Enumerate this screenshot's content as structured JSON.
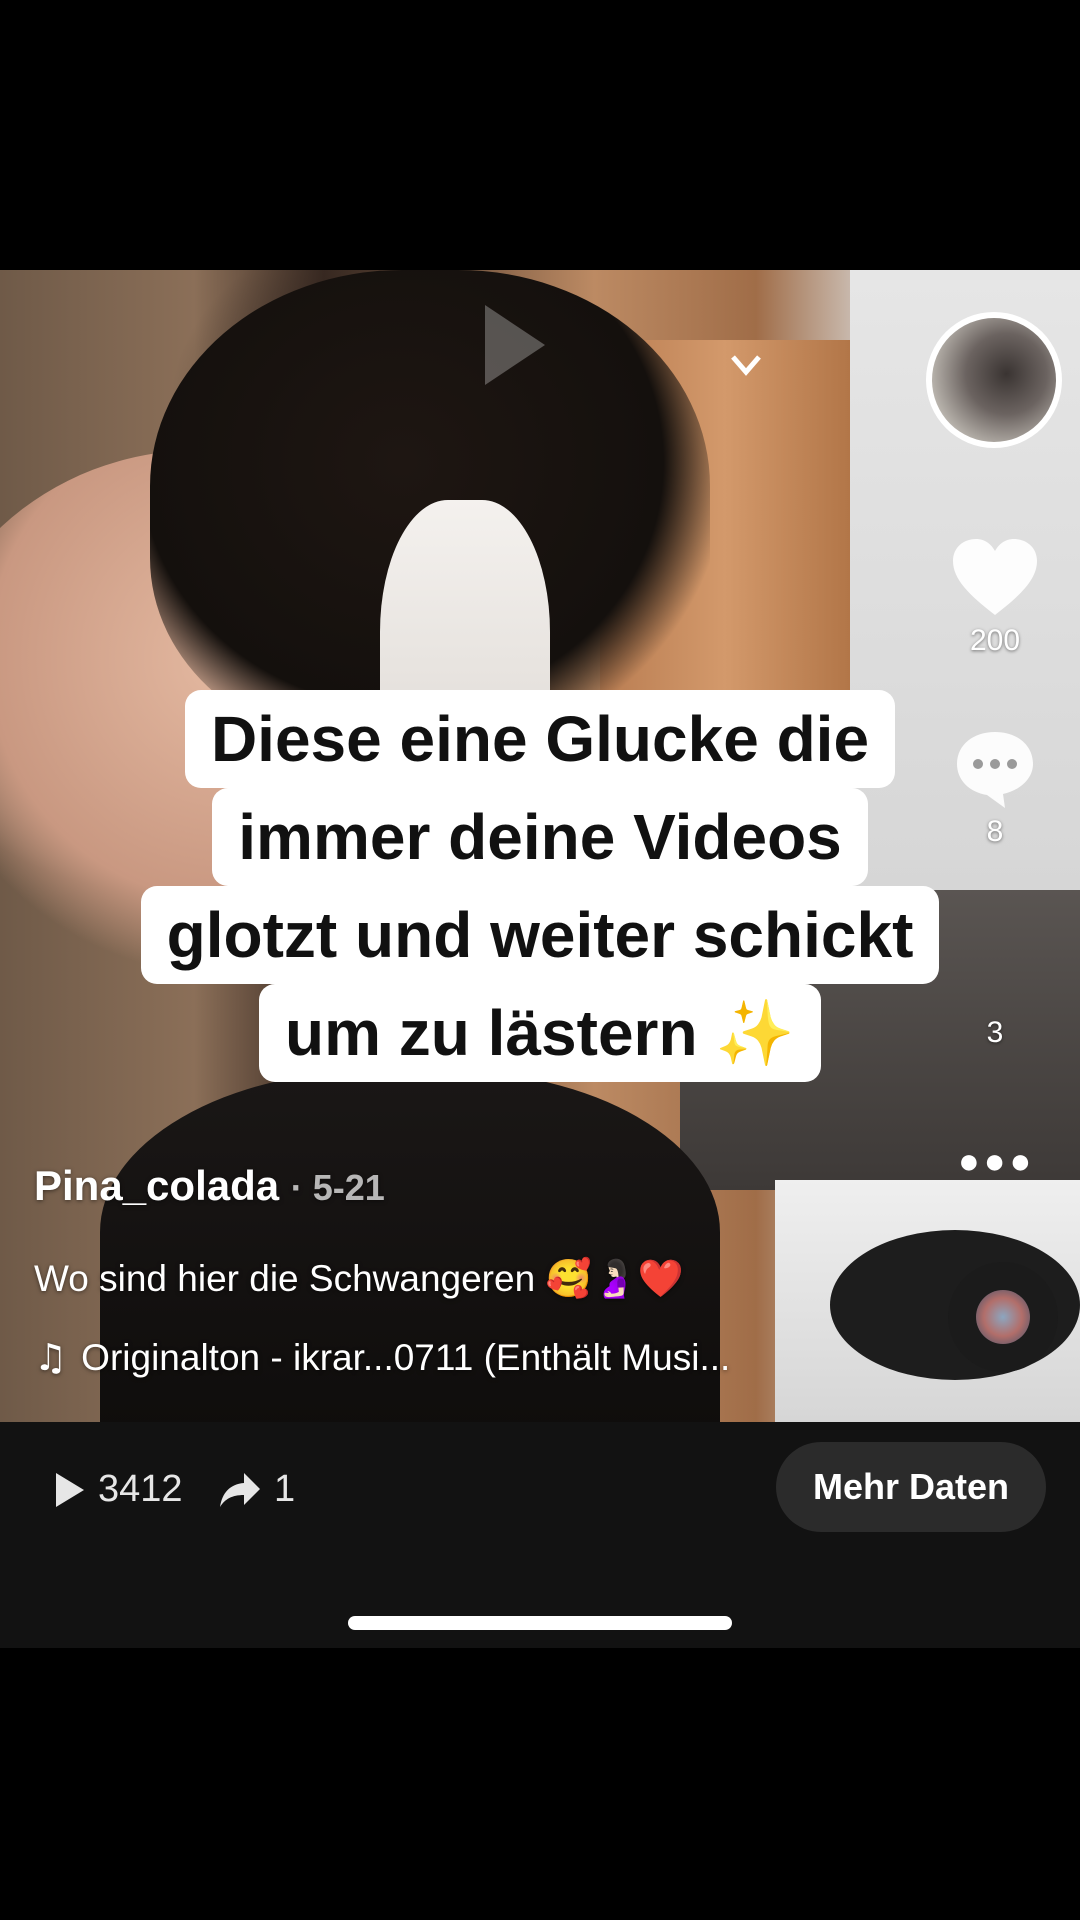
{
  "video": {
    "caption_lines": [
      "Diese eine Glucke die",
      "immer deine Videos",
      "glotzt und weiter schickt",
      "um zu lästern ✨"
    ]
  },
  "sidebar": {
    "likes": "200",
    "comments": "8",
    "shares": "3"
  },
  "post": {
    "author": "Pina_colada",
    "date": "· 5-21",
    "description": "Wo sind hier die Schwangeren 🥰🤰🏻❤️",
    "music": "Originalton - ikrar...0711 (Enthält Musi..."
  },
  "stats": {
    "views": "3412",
    "shares": "1",
    "more_button": "Mehr Daten"
  },
  "icons": {
    "play": "play-icon",
    "share": "share-arrow-icon",
    "heart": "heart-icon",
    "comment": "comment-icon",
    "music": "music-note-icon"
  },
  "colors": {
    "stats_bar_bg": "#121212",
    "button_bg": "#2b2b2b",
    "caption_bg": "#ffffff"
  }
}
